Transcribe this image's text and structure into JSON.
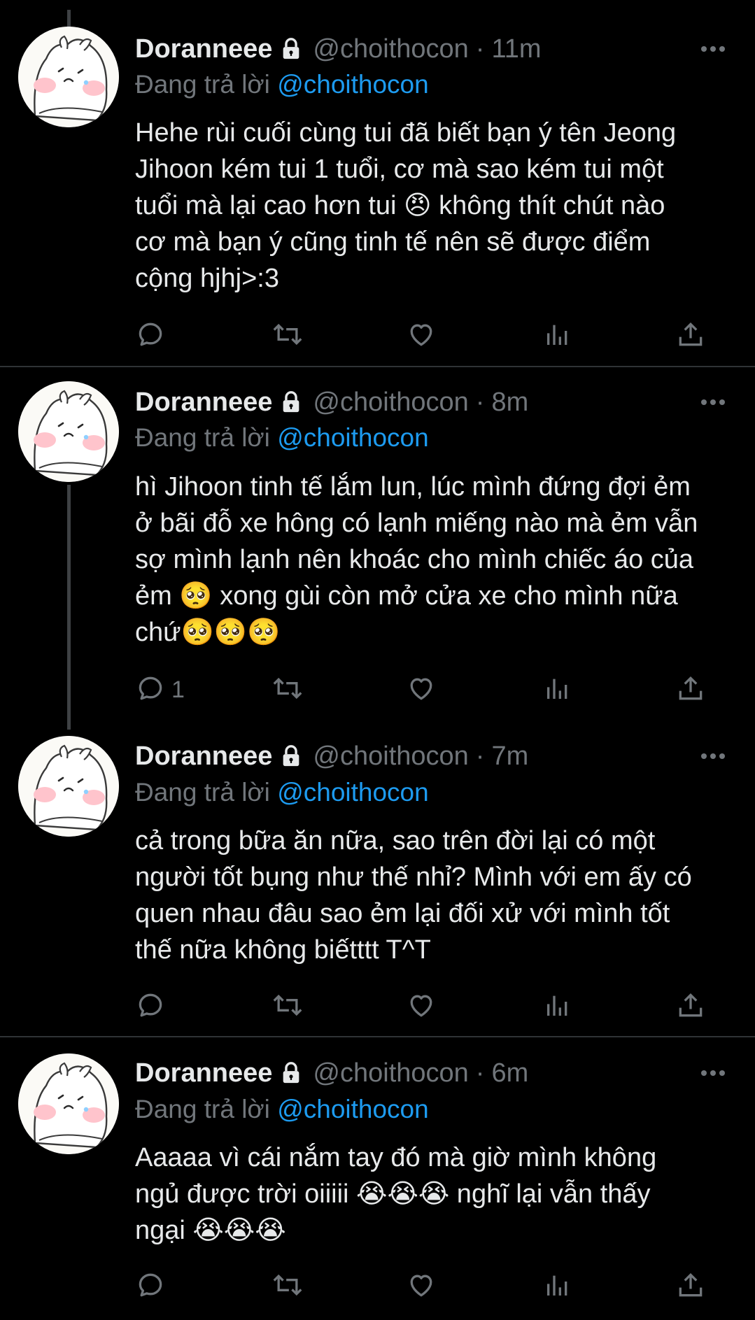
{
  "tweets": [
    {
      "display_name": "Doranneee",
      "handle": "@choithocon",
      "separator": "·",
      "time": "11m",
      "reply_prefix": "Đang trả lời",
      "reply_to": "@choithocon",
      "text": "Hehe rùi cuối cùng tui đã biết bạn ý tên Jeong\nJihoon kém tui 1 tuổi, cơ mà sao kém tui một\ntuổi mà lại cao hơn tui 😠 không thít chút nào\ncơ mà bạn ý cũng tinh tế nên sẽ được điểm\ncộng hjhj>:3",
      "reply_count": ""
    },
    {
      "display_name": "Doranneee",
      "handle": "@choithocon",
      "separator": "·",
      "time": "8m",
      "reply_prefix": "Đang trả lời",
      "reply_to": "@choithocon",
      "text": "hì Jihoon tinh tế lắm lun, lúc mình đứng đợi ẻm\nở bãi đỗ xe hông có lạnh miếng nào mà ẻm vẫn\nsợ mình lạnh nên khoác cho mình chiếc áo của\nẻm 🥺 xong gùi còn mở cửa xe cho mình nữa\nchứ🥺🥺🥺",
      "reply_count": "1"
    },
    {
      "display_name": "Doranneee",
      "handle": "@choithocon",
      "separator": "·",
      "time": "7m",
      "reply_prefix": "Đang trả lời",
      "reply_to": "@choithocon",
      "text": "cả trong bữa ăn nữa, sao trên đời lại có một\nngười tốt bụng như thế nhỉ? Mình với em ấy có\nquen nhau đâu sao ẻm lại đối xử với mình tốt\nthế nữa không biếtttt T^T",
      "reply_count": ""
    },
    {
      "display_name": "Doranneee",
      "handle": "@choithocon",
      "separator": "·",
      "time": "6m",
      "reply_prefix": "Đang trả lời",
      "reply_to": "@choithocon",
      "text": "Aaaaa vì cái nắm tay đó mà giờ mình không\nngủ được trời oiiiii 😭😭😭 nghĩ lại vẫn thấy\nngại 😭😭😭",
      "reply_count": ""
    }
  ],
  "icons": {
    "lock": "lock-icon",
    "more": "more-icon",
    "reply": "reply-icon",
    "retweet": "retweet-icon",
    "like": "like-icon",
    "views": "views-icon",
    "share": "share-icon"
  },
  "colors": {
    "background": "#000000",
    "text": "#e7e9ea",
    "muted": "#71767b",
    "link": "#1d9bf0",
    "divider": "#2f3336",
    "thread_line": "#3e4144"
  }
}
